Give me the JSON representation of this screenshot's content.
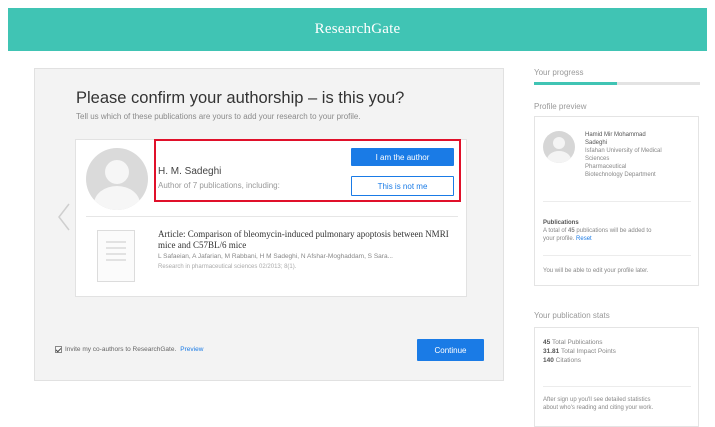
{
  "header": {
    "brand": "ResearchGate",
    "color": "#40c4b4"
  },
  "main": {
    "heading": "Please confirm your authorship – is this you?",
    "subheading": "Tell us which of these publications are yours to add your research to your profile.",
    "author": {
      "name": "H. M. Sadeghi",
      "subtitle": "Author of 7 publications, including:"
    },
    "buttons": {
      "confirm": "I am the author",
      "reject": "This is not me",
      "continue": "Continue"
    },
    "article": {
      "title": "Article: Comparison of bleomycin-induced pulmonary apoptosis between NMRI mice and C57BL/6 mice",
      "authors": "L Safaeian, A Jafarian, M Rabbani, H M Sadeghi, N Afshar-Moghaddam, S Sara...",
      "journal": "Research in pharmaceutical sciences 02/2013; 8(1)."
    },
    "invite": {
      "label": "Invite my co-authors to ResearchGate.",
      "preview": "Preview",
      "checked": true
    },
    "accent_color": "#1a7be6",
    "highlight_color": "#e0102a"
  },
  "sidebar": {
    "progress_title": "Your progress",
    "progress_fraction": 0.5,
    "preview_title": "Profile preview",
    "profile": {
      "name_line1": "Hamid Mir Mohammad",
      "name_line2": "Sadeghi",
      "affil_line1": "Isfahan University of Medical",
      "affil_line2": "Sciences",
      "affil_line3": "Pharmaceutical",
      "affil_line4": "Biotechnology Department"
    },
    "publications": {
      "label": "Publications",
      "text_before": "A total of",
      "count": "45",
      "text_after": "publications will be added to",
      "text_line2": "your profile.",
      "reset": "Reset",
      "edit_note": "You will be able to edit your profile later."
    },
    "stats_title": "Your publication stats",
    "stats": [
      {
        "value": "45",
        "label": "Total Publications"
      },
      {
        "value": "31.81",
        "label": "Total Impact Points"
      },
      {
        "value": "140",
        "label": "Citations"
      }
    ],
    "stats_note_line1": "After sign up you'll see detailed statistics",
    "stats_note_line2": "about who's reading and citing your work."
  }
}
